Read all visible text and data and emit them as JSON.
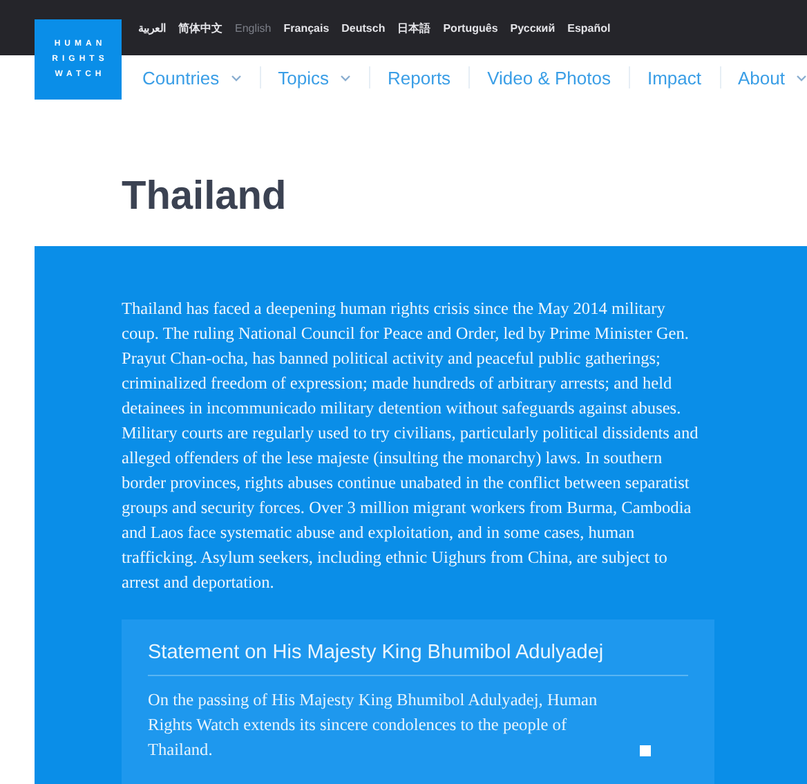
{
  "logo": {
    "lines": [
      "HUMAN",
      "RIGHTS",
      "WATCH"
    ]
  },
  "languages": [
    {
      "label": "العربية",
      "selected": false
    },
    {
      "label": "简体中文",
      "selected": false
    },
    {
      "label": "English",
      "selected": true
    },
    {
      "label": "Français",
      "selected": false
    },
    {
      "label": "Deutsch",
      "selected": false
    },
    {
      "label": "日本語",
      "selected": false
    },
    {
      "label": "Português",
      "selected": false
    },
    {
      "label": "Русский",
      "selected": false
    },
    {
      "label": "Español",
      "selected": false
    }
  ],
  "nav": [
    {
      "label": "Countries",
      "has_menu": true
    },
    {
      "label": "Topics",
      "has_menu": true
    },
    {
      "label": "Reports",
      "has_menu": false
    },
    {
      "label": "Video & Photos",
      "has_menu": false
    },
    {
      "label": "Impact",
      "has_menu": false
    },
    {
      "label": "About",
      "has_menu": true
    }
  ],
  "title": "Thailand",
  "intro": "Thailand has faced a deepening human rights crisis since the May 2014 military coup. The ruling National Council for Peace and Order, led by Prime Minister Gen. Prayut Chan-ocha, has banned political activity and peaceful public gatherings; criminalized freedom of expression; made hundreds of arbitrary arrests; and held detainees in incommunicado military detention without safeguards against abuses. Military courts are regularly used to try civilians, particularly political dissidents and alleged offenders of the lese majeste (insulting the monarchy) laws. In southern border provinces, rights abuses continue unabated in the conflict between separatist groups and security forces. Over 3 million migrant workers from Burma, Cambodia and Laos face systematic abuse and exploitation, and in some cases, human trafficking. Asylum seekers, including ethnic Uighurs from China, are subject to arrest and deportation.",
  "statement": {
    "heading": "Statement on His Majesty King Bhumibol Adulyadej",
    "text": "On the passing of His Majesty King Bhumibol Adulyadej, Human Rights Watch extends its sincere condolences to the people of Thailand."
  }
}
